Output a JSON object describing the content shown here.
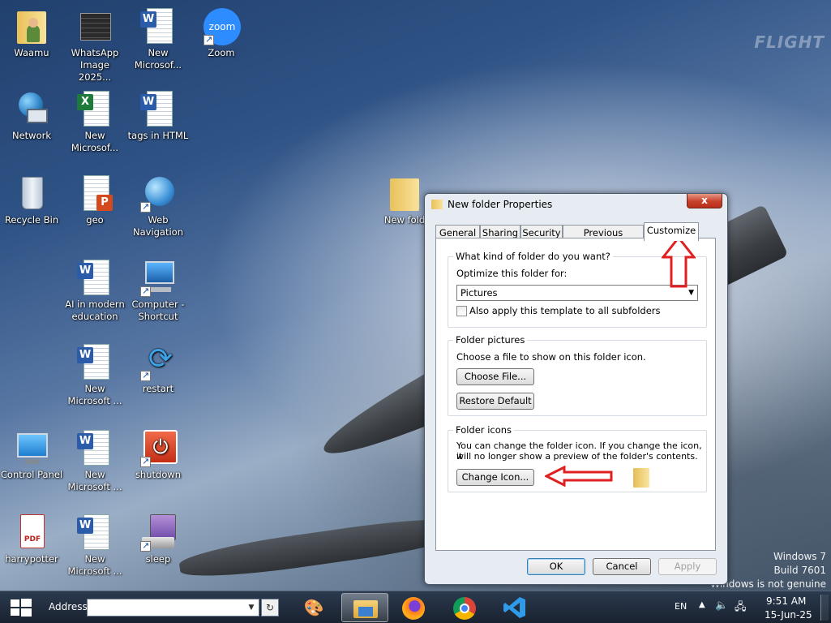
{
  "desktop": {
    "icons": [
      {
        "label": "Waamu"
      },
      {
        "label": "WhatsApp Image 2025..."
      },
      {
        "label": "New Microsof..."
      },
      {
        "label": "Zoom",
        "badge": "zoom"
      },
      {
        "label": "Network"
      },
      {
        "label": "New Microsof..."
      },
      {
        "label": "tags in HTML"
      },
      {
        "label": "Recycle Bin"
      },
      {
        "label": "geo"
      },
      {
        "label": "Web Navigation"
      },
      {
        "label": "AI in modern education"
      },
      {
        "label": "Computer - Shortcut"
      },
      {
        "label": "New Microsoft ..."
      },
      {
        "label": "restart"
      },
      {
        "label": "Control Panel"
      },
      {
        "label": "New Microsoft ..."
      },
      {
        "label": "shutdown"
      },
      {
        "label": "harrypotter",
        "badge": "PDF"
      },
      {
        "label": "New Microsoft ..."
      },
      {
        "label": "sleep"
      },
      {
        "label": "New fold"
      }
    ],
    "word_badge": "W",
    "excel_badge": "X",
    "ppt_badge": "P",
    "watermark": {
      "line1": "Windows 7",
      "line2": "Build 7601",
      "line3": "Windows is not genuine"
    },
    "wallpaper_logo": "FLIGHT"
  },
  "dialog": {
    "title": "New folder Properties",
    "close_label": "x",
    "tabs": [
      "General",
      "Sharing",
      "Security",
      "Previous Versions",
      "Customize"
    ],
    "selected_tab": "Customize",
    "group1": {
      "title": "What kind of folder do you want?",
      "optimize_label": "Optimize this folder for:",
      "select_value": "Pictures",
      "checkbox_label": "Also apply this template to all subfolders"
    },
    "group2": {
      "title": "Folder pictures",
      "description": "Choose a file to show on this folder icon.",
      "choose_file": "Choose File...",
      "restore_default": "Restore Default"
    },
    "group3": {
      "title": "Folder icons",
      "description_line1": "You can change the folder icon. If you change the icon, it",
      "description_line2": "will no longer show a preview of the folder's contents.",
      "change_icon": "Change Icon..."
    },
    "ok": "OK",
    "cancel": "Cancel",
    "apply": "Apply"
  },
  "taskbar": {
    "address_label": "Address",
    "address_value": "",
    "language": "EN",
    "time": "9:51 AM",
    "date": "15-Jun-25"
  },
  "colors": {
    "annotation_arrow": "#e02020"
  }
}
